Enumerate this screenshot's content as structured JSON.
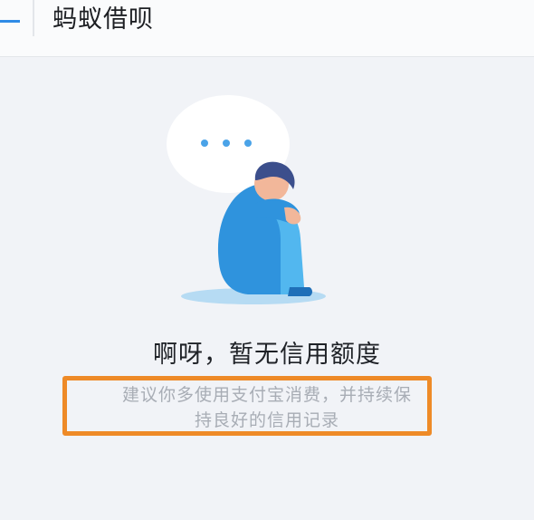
{
  "header": {
    "title": "蚂蚁借呗",
    "back_icon": "back-arrow-icon"
  },
  "empty_state": {
    "illustration_icon": "sad-person-speech-bubble-icon",
    "title": "啊呀，暂无信用额度",
    "description_line1": "建议你多使用支付宝消费，并持续保",
    "description_line2": "持良好的信用记录"
  },
  "colors": {
    "accent": "#2f8be6",
    "highlight_border": "#ee8a27",
    "background": "#f1f3f7",
    "title_text": "#1f2227",
    "description_text": "#a8adb5"
  }
}
